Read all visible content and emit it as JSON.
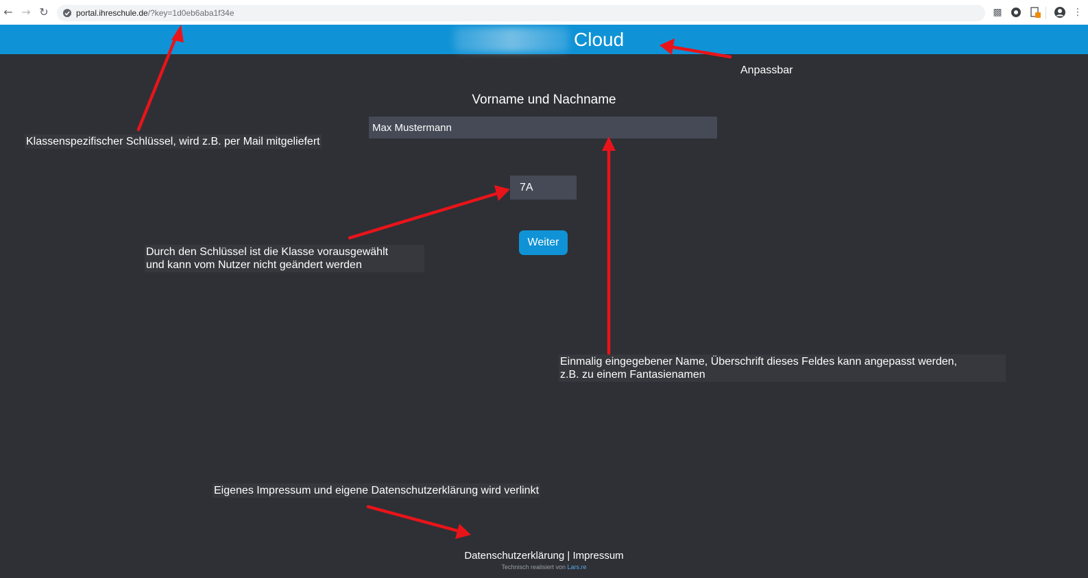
{
  "browser": {
    "url_host": "portal.ihreschule.de",
    "url_path": "/?key=1d0eb6aba1f34e",
    "icons": [
      "back-arrow-icon",
      "forward-arrow-icon",
      "reload-icon",
      "site-info-icon",
      "screenshot-extension-icon",
      "camera-extension-icon",
      "document-extension-icon",
      "profile-icon",
      "more-menu-icon"
    ]
  },
  "header": {
    "title": "Cloud",
    "color": "#0f93d6"
  },
  "form": {
    "label": "Vorname und Nachname",
    "name_value": "Max Mustermann",
    "class_value": "7A",
    "submit_label": "Weiter"
  },
  "footer": {
    "privacy_link": "Datenschutzerklärung",
    "separator": "|",
    "imprint_link": "Impressum",
    "credit_text": "Technisch realisiert von",
    "credit_link": "Lars.re"
  },
  "annotations": {
    "header_note": "Anpassbar",
    "key_note": "Klassenspezifischer Schlüssel, wird z.B. per Mail mitgeliefert",
    "class_note_line1": "Durch den Schlüssel ist die Klasse vorausgewählt",
    "class_note_line2": "und kann vom Nutzer nicht geändert werden",
    "name_note_line1": "Einmalig eingegebener Name, Überschrift dieses Feldes kann angepasst werden,",
    "name_note_line2": "z.B. zu einem Fantasienamen",
    "footer_note": "Eigenes Impressum und eigene Datenschutzerklärung wird verlinkt",
    "arrow_color": "#e8141a"
  }
}
